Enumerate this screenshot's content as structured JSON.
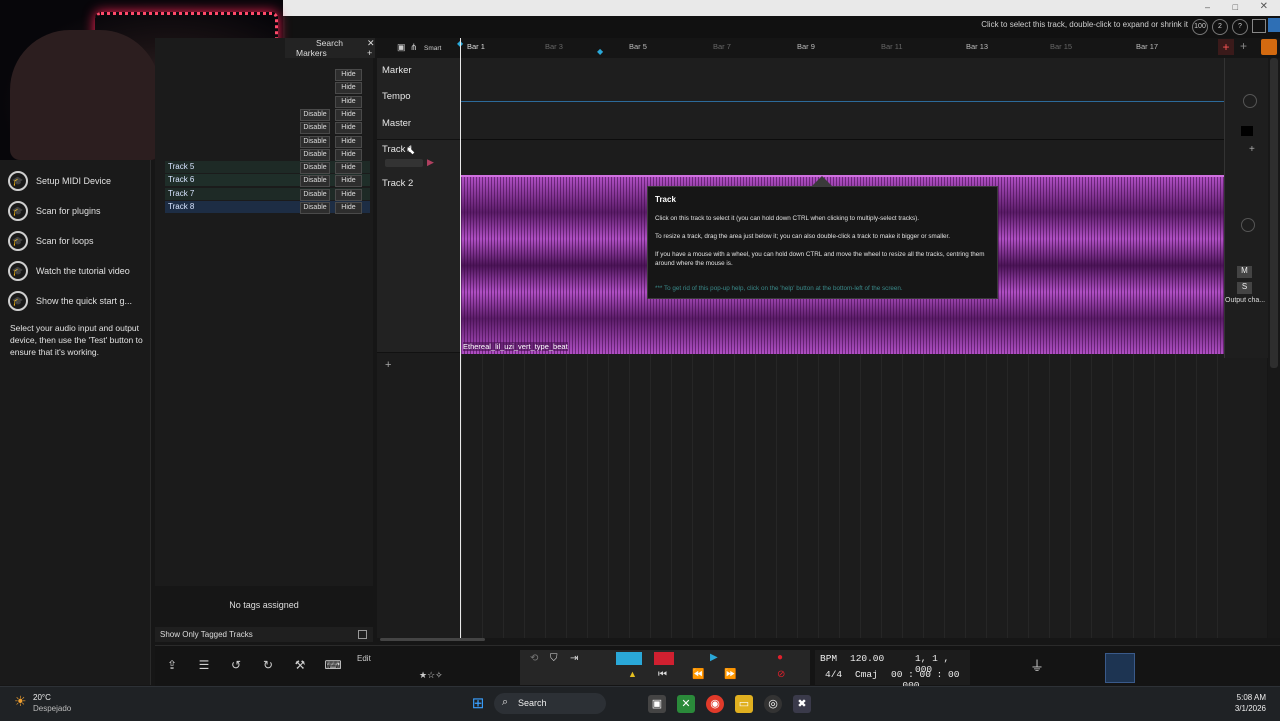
{
  "hint": "Click to select this track, double-click to expand or shrink it",
  "hint_zoom": "100",
  "tag_header": {
    "search": "Search",
    "markers": "Markers"
  },
  "track_rows": [
    {
      "name": "",
      "disable": "",
      "hide": "Hide"
    },
    {
      "name": "",
      "disable": "",
      "hide": "Hide"
    },
    {
      "name": "",
      "disable": "",
      "hide": "Hide"
    },
    {
      "name": "",
      "disable": "Disable",
      "hide": "Hide"
    },
    {
      "name": "",
      "disable": "Disable",
      "hide": "Hide"
    },
    {
      "name": "",
      "disable": "Disable",
      "hide": "Hide"
    },
    {
      "name": "",
      "disable": "Disable",
      "hide": "Hide"
    },
    {
      "name": "Track 5",
      "disable": "Disable",
      "hide": "Hide"
    },
    {
      "name": "Track 6",
      "disable": "Disable",
      "hide": "Hide"
    },
    {
      "name": "Track 7",
      "disable": "Disable",
      "hide": "Hide"
    },
    {
      "name": "Track 8",
      "disable": "Disable",
      "hide": "Hide"
    }
  ],
  "no_tags": "No tags assigned",
  "show_only_tagged": "Show Only Tagged Tracks",
  "help_items": [
    "Setup MIDI Device",
    "Scan for plugins",
    "Scan for loops",
    "Watch the tutorial video",
    "Show the quick start g..."
  ],
  "help_text": "Select your audio input and output device, then use the 'Test' button to ensure that it's working.",
  "ruler": {
    "smart": "Smart",
    "bars": [
      "Bar 1",
      "Bar 3",
      "Bar 5",
      "Bar 7",
      "Bar 9",
      "Bar 11",
      "Bar 13",
      "Bar 15",
      "Bar 17"
    ]
  },
  "tracks": {
    "marker": "Marker",
    "tempo": "Tempo",
    "master": "Master",
    "track1": "Track 1",
    "track2": "Track 2"
  },
  "clip_name": "Ethereal_lil_uzi_vert_type_beat",
  "right_labels": {
    "m": "M",
    "s": "S",
    "output": "Output cha..."
  },
  "tooltip": {
    "title": "Track",
    "line1": "Click on this track to select it (you can hold down CTRL when clicking to multiply-select tracks).",
    "line2": "To resize a track, drag the area just below it; you can also double-click a track to make it bigger or smaller.",
    "line3": "If you have a mouse with a wheel, you can hold down CTRL and move the wheel to resize all the tracks, centring them around where the mouse is.",
    "footer": "*** To get rid of this pop-up help, click on the 'help' button at the bottom-left of the screen."
  },
  "transport": {
    "edit": "Edit",
    "bpm_label": "BPM",
    "bpm": "120.00",
    "position": "1, 1 , 000",
    "timesig": "4/4",
    "key": "Cmaj",
    "time": "00 : 00 : 00 . 000"
  },
  "taskbar": {
    "temp": "20°C",
    "weather": "Despejado",
    "search": "Search",
    "time": "5:08 AM",
    "date": "3/1/2026"
  },
  "colors": {
    "clip": "#b04fc4",
    "accent": "#2aa8d8",
    "record": "#e0202c"
  }
}
